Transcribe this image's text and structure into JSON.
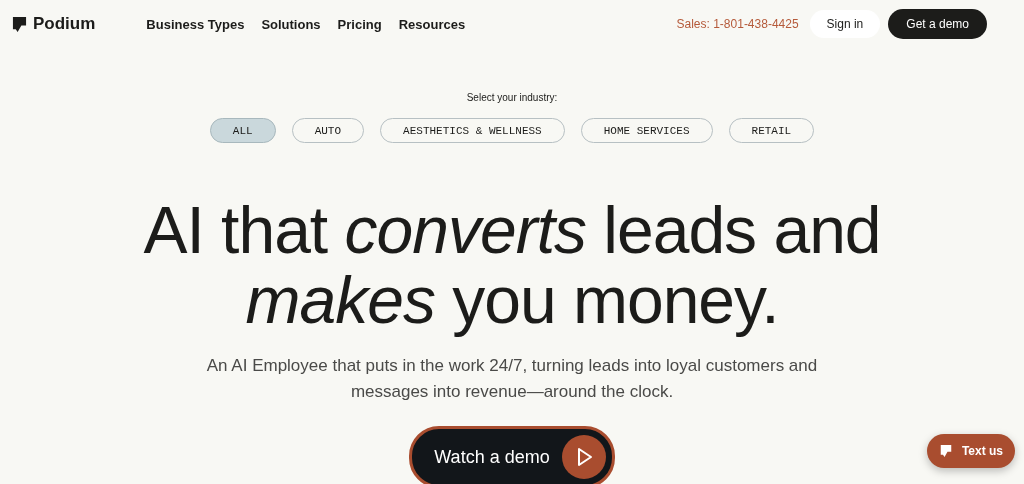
{
  "header": {
    "logo": "Podium",
    "nav": [
      "Business Types",
      "Solutions",
      "Pricing",
      "Resources"
    ],
    "sales": "Sales: 1-801-438-4425",
    "sign_in": "Sign in",
    "cta": "Get a demo"
  },
  "industry": {
    "label": "Select your industry:",
    "options": [
      {
        "label": "ALL",
        "selected": true
      },
      {
        "label": "AUTO",
        "selected": false
      },
      {
        "label": "AESTHETICS & WELLNESS",
        "selected": false
      },
      {
        "label": "HOME SERVICES",
        "selected": false
      },
      {
        "label": "RETAIL",
        "selected": false
      }
    ]
  },
  "hero": {
    "headline": "AI that *converts* leads and *makes* you money.",
    "subtitle": "An AI Employee that puts in the work 24/7, turning leads into loyal customers and messages into revenue—around the clock.",
    "button": "Watch a demo"
  },
  "chat_button": "Text us"
}
